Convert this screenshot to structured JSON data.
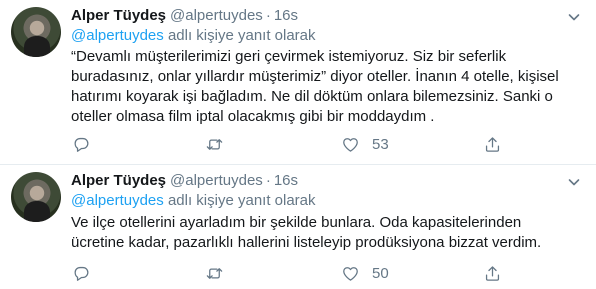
{
  "tweets": [
    {
      "author_name": "Alper Tüydeş",
      "handle": "@alpertuydes",
      "separator": "·",
      "time": "16s",
      "reply_prefix": "@alpertuydes",
      "reply_suffix": " adlı kişiye yanıt olarak",
      "lines": [
        "“Devamlı müşterilerimizi geri çevirmek istemiyoruz. Siz bir seferlik",
        "buradasınız, onlar yıllardır müşterimiz” diyor oteller. İnanın 4 otelle, kişisel",
        "hatırımı koyarak işi bağladım. Ne dil döktüm onlara bilemezsiniz. Sanki o",
        "oteller olmasa film iptal olacakmış gibi bir moddaydım ."
      ],
      "like_count": "53"
    },
    {
      "author_name": "Alper Tüydeş",
      "handle": "@alpertuydes",
      "separator": "·",
      "time": "16s",
      "reply_prefix": "@alpertuydes",
      "reply_suffix": " adlı kişiye yanıt olarak",
      "lines": [
        "Ve ilçe otellerini ayarladım bir şekilde bunlara. Oda kapasitelerinden",
        "ücretine kadar, pazarlıklı hallerini listeleyip prodüksiyona bizzat verdim."
      ],
      "like_count": "50"
    }
  ],
  "icons": {
    "reply": "reply-icon",
    "retweet": "retweet-icon",
    "like": "heart-icon",
    "share": "share-icon",
    "more": "chevron-down-icon"
  },
  "colors": {
    "text": "#14171a",
    "muted": "#657786",
    "link": "#1da1f2",
    "divider": "#e6ecf0"
  }
}
